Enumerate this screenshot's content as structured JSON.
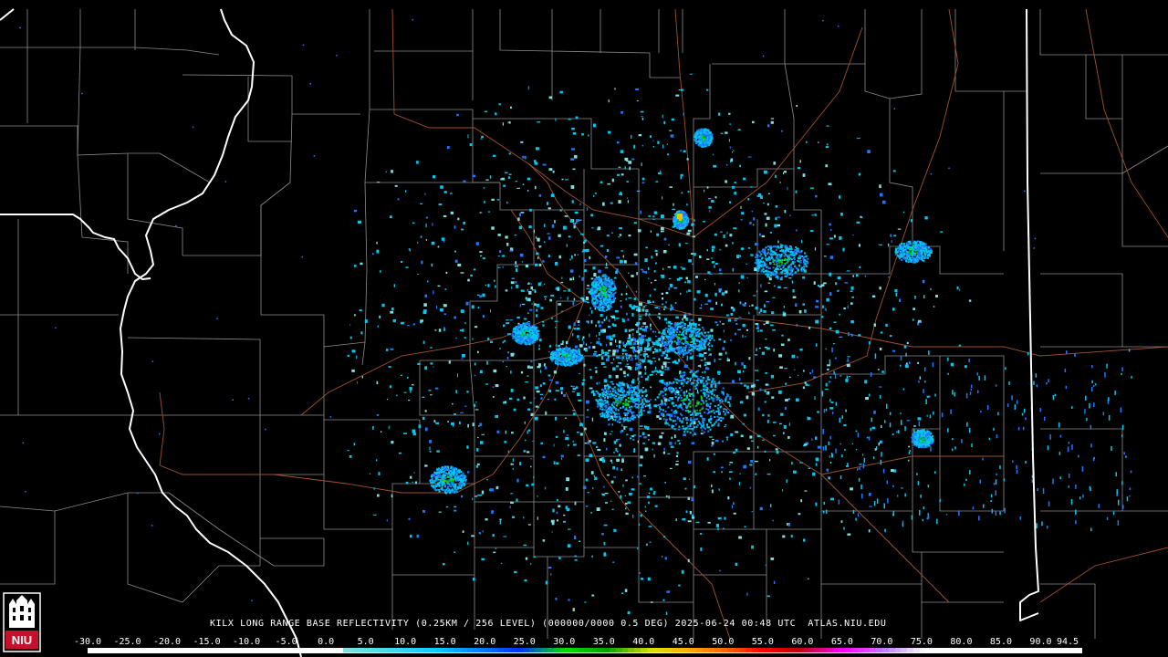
{
  "title": "KILX LONG RANGE BASE REFLECTIVITY (0.25KM / 256 LEVEL) (000000/0000 0.5 DEG) 2025-06-24 00:48 UTC  ATLAS.NIU.EDU",
  "logo_text": "NIU",
  "scale": {
    "labels": [
      "-30.0",
      "-25.0",
      "-20.0",
      "-15.0",
      "-10.0",
      "-5.0",
      "0.0",
      "5.0",
      "10.0",
      "15.0",
      "20.0",
      "25.0",
      "30.0",
      "35.0",
      "40.0",
      "45.0",
      "50.0",
      "55.0",
      "60.0",
      "65.0",
      "70.0",
      "75.0",
      "80.0",
      "85.0",
      "90.0",
      "94.5"
    ],
    "colors": [
      "#ffffff",
      "#ffffff",
      "#ffffff",
      "#ffffff",
      "#ffffff",
      "#ffffff",
      "#7fdede",
      "#00c8f0",
      "#1e78ff",
      "#0000c8",
      "#00dc00",
      "#00a000",
      "#d2d200",
      "#ffb400",
      "#ff7800",
      "#ff0000",
      "#c80000",
      "#a00000",
      "#ff00ff",
      "#c864ff",
      "#ffffff",
      "#ffffff",
      "#ffffff",
      "#ffffff",
      "#ffffff"
    ]
  },
  "map": {
    "background": "#000000",
    "county_color": "#9a9a9a",
    "state_color": "#ffffff",
    "highway_color": "#a0522d",
    "echo_colors": [
      "#00c8f0",
      "#1e78ff",
      "#7fdede",
      "#00dc00",
      "#00a000"
    ]
  }
}
